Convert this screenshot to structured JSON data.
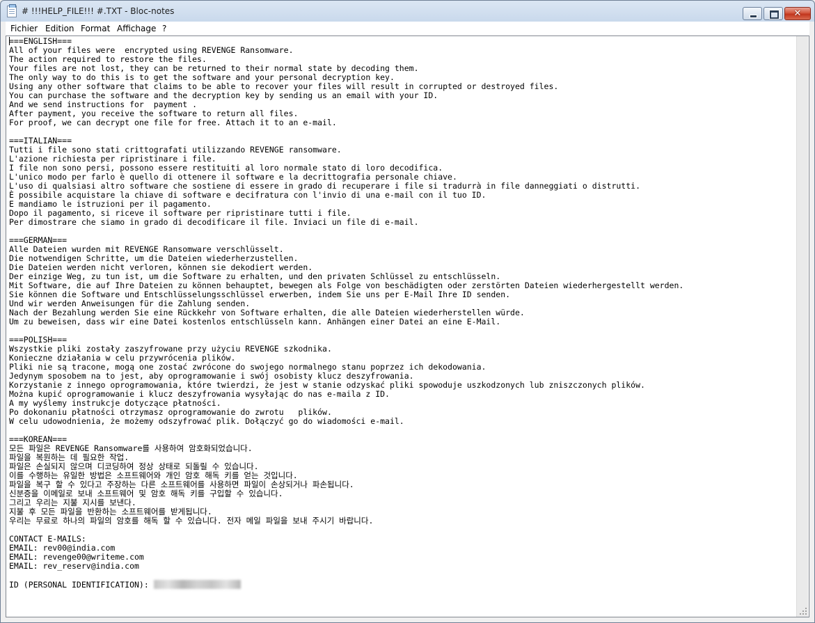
{
  "window": {
    "title": "# !!!HELP_FILE!!! #.TXT - Bloc-notes",
    "buttons": {
      "close": "✕"
    }
  },
  "menu": [
    "Fichier",
    "Edition",
    "Format",
    "Affichage",
    "?"
  ],
  "document": {
    "lines": [
      "===ENGLISH===",
      "All of your files were  encrypted using REVENGE Ransomware.",
      "The action required to restore the files.",
      "Your files are not lost, they can be returned to their normal state by decoding them.",
      "The only way to do this is to get the software and your personal decryption key.",
      "Using any other software that claims to be able to recover your files will result in corrupted or destroyed files.",
      "You can purchase the software and the decryption key by sending us an email with your ID.",
      "And we send instructions for  payment .",
      "After payment, you receive the software to return all files.",
      "For proof, we can decrypt one file for free. Attach it to an e-mail.",
      "",
      "===ITALIAN===",
      "Tutti i file sono stati crittografati utilizzando REVENGE ransomware.",
      "L'azione richiesta per ripristinare i file.",
      "I file non sono persi, possono essere restituiti al loro normale stato di loro decodifica.",
      "L'unico modo per farlo è quello di ottenere il software e la decrittografia personale chiave.",
      "L'uso di qualsiasi altro software che sostiene di essere in grado di recuperare i file si tradurrà in file danneggiati o distrutti.",
      "È possibile acquistare la chiave di software e decifratura con l'invio di una e-mail con il tuo ID.",
      "E mandiamo le istruzioni per il pagamento.",
      "Dopo il pagamento, si riceve il software per ripristinare tutti i file.",
      "Per dimostrare che siamo in grado di decodificare il file. Inviaci un file di e-mail.",
      "",
      "===GERMAN===",
      "Alle Dateien wurden mit REVENGE Ransomware verschlüsselt.",
      "Die notwendigen Schritte, um die Dateien wiederherzustellen.",
      "Die Dateien werden nicht verloren, können sie dekodiert werden.",
      "Der einzige Weg, zu tun ist, um die Software zu erhalten, und den privaten Schlüssel zu entschlüsseln.",
      "Mit Software, die auf Ihre Dateien zu können behauptet, bewegen als Folge von beschädigten oder zerstörten Dateien wiederhergestellt werden.",
      "Sie können die Software und Entschlüsselungsschlüssel erwerben, indem Sie uns per E-Mail Ihre ID senden.",
      "Und wir werden Anweisungen für die Zahlung senden.",
      "Nach der Bezahlung werden Sie eine Rückkehr von Software erhalten, die alle Dateien wiederherstellen würde.",
      "Um zu beweisen, dass wir eine Datei kostenlos entschlüsseln kann. Anhängen einer Datei an eine E-Mail.",
      "",
      "===POLISH===",
      "Wszystkie pliki zostały zaszyfrowane przy użyciu REVENGE szkodnika.",
      "Konieczne działania w celu przywrócenia plików.",
      "Pliki nie są tracone, mogą one zostać zwrócone do swojego normalnego stanu poprzez ich dekodowania.",
      "Jedynym sposobem na to jest, aby oprogramowanie i swój osobisty klucz deszyfrowania.",
      "Korzystanie z innego oprogramowania, które twierdzi, że jest w stanie odzyskać pliki spowoduje uszkodzonych lub zniszczonych plików.",
      "Można kupić oprogramowanie i klucz deszyfrowania wysyłając do nas e-maila z ID.",
      "A my wyślemy instrukcje dotyczące płatności.",
      "Po dokonaniu płatności otrzymasz oprogramowanie do zwrotu   plików.",
      "W celu udowodnienia, że możemy odszyfrować plik. Dołączyć go do wiadomości e-mail.",
      "",
      "===KOREAN===",
      "모든 파일은 REVENGE Ransomware를 사용하여 암호화되었습니다.",
      "파일을 복원하는 데 필요한 작업.",
      "파일은 손실되지 않으며 디코딩하여 정상 상태로 되돌릴 수 있습니다.",
      "이를 수행하는 유일한 방법은 소프트웨어와 개인 암호 해독 키를 얻는 것입니다.",
      "파일을 복구 할 수 있다고 주장하는 다른 소프트웨어를 사용하면 파일이 손상되거나 파손됩니다.",
      "신분증을 이메일로 보내 소프트웨어 및 암호 해독 키를 구입할 수 있습니다.",
      "그리고 우리는 지불 지시를 보낸다.",
      "지불 후 모든 파일을 반환하는 소프트웨어를 받게됩니다.",
      "우리는 무료로 하나의 파일의 암호를 해독 할 수 있습니다. 전자 메일 파일을 보내 주시기 바랍니다.",
      "",
      "CONTACT E-MAILS:",
      "EMAIL: rev00@india.com",
      "EMAIL: revenge00@writeme.com",
      "EMAIL: rev_reserv@india.com",
      "",
      "ID (PERSONAL IDENTIFICATION): "
    ]
  }
}
